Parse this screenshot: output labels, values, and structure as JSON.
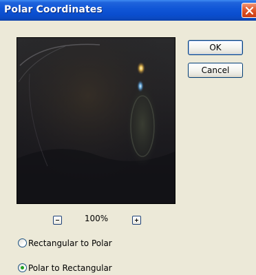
{
  "window": {
    "title": "Polar Coordinates"
  },
  "buttons": {
    "ok_label": "OK",
    "cancel_label": "Cancel"
  },
  "zoom": {
    "value": "100%"
  },
  "options": [
    {
      "label": "Rectangular to Polar",
      "selected": false
    },
    {
      "label": "Polar to Rectangular",
      "selected": true
    }
  ],
  "icons": {
    "close": "close-icon",
    "zoom_out": "minus-icon",
    "zoom_in": "plus-icon"
  },
  "colors": {
    "titlebar": "#0a4ecf",
    "dialog_bg": "#ece9d8",
    "close_button": "#d7481c",
    "radio_selected": "#21a121"
  }
}
